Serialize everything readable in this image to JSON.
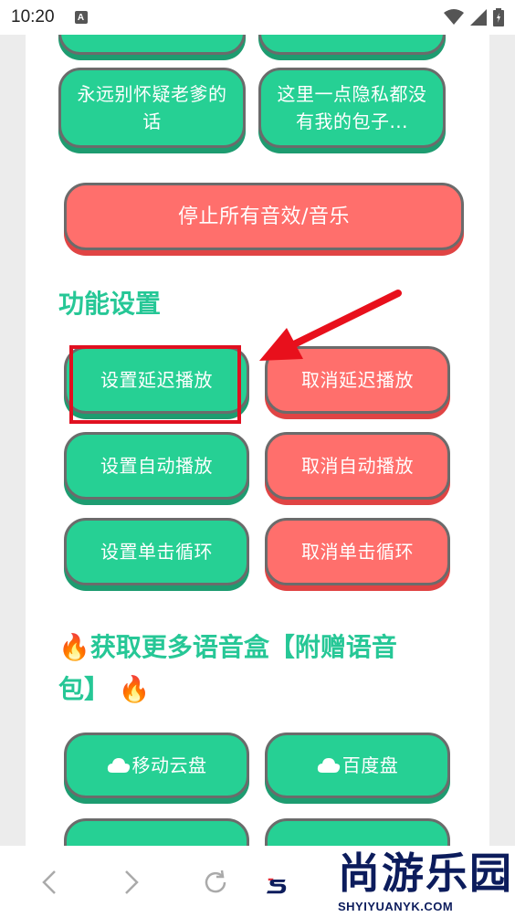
{
  "status_bar": {
    "time": "10:20",
    "notification_letter": "A"
  },
  "sound_buttons": [
    {
      "label": "永远别怀疑老爹的话"
    },
    {
      "label": "这里一点隐私都没有我的包子..."
    }
  ],
  "stop_all_label": "停止所有音效/音乐",
  "settings": {
    "title": "功能设置",
    "set_delay": "设置延迟播放",
    "cancel_delay": "取消延迟播放",
    "set_auto": "设置自动播放",
    "cancel_auto": "取消自动播放",
    "set_loop": "设置单击循环",
    "cancel_loop": "取消单击循环"
  },
  "more": {
    "title_line1": "获取更多语音盒【附赠语音",
    "title_line2": "包】",
    "mobile_cloud": "移动云盘",
    "baidu": "百度盘"
  },
  "watermark": {
    "text": "尚游乐园",
    "sub": "SHYIYUANYK.COM"
  },
  "colors": {
    "green": "#26d094",
    "red": "#ff6f6c",
    "title_green": "#26c796",
    "highlight": "#e01020"
  }
}
